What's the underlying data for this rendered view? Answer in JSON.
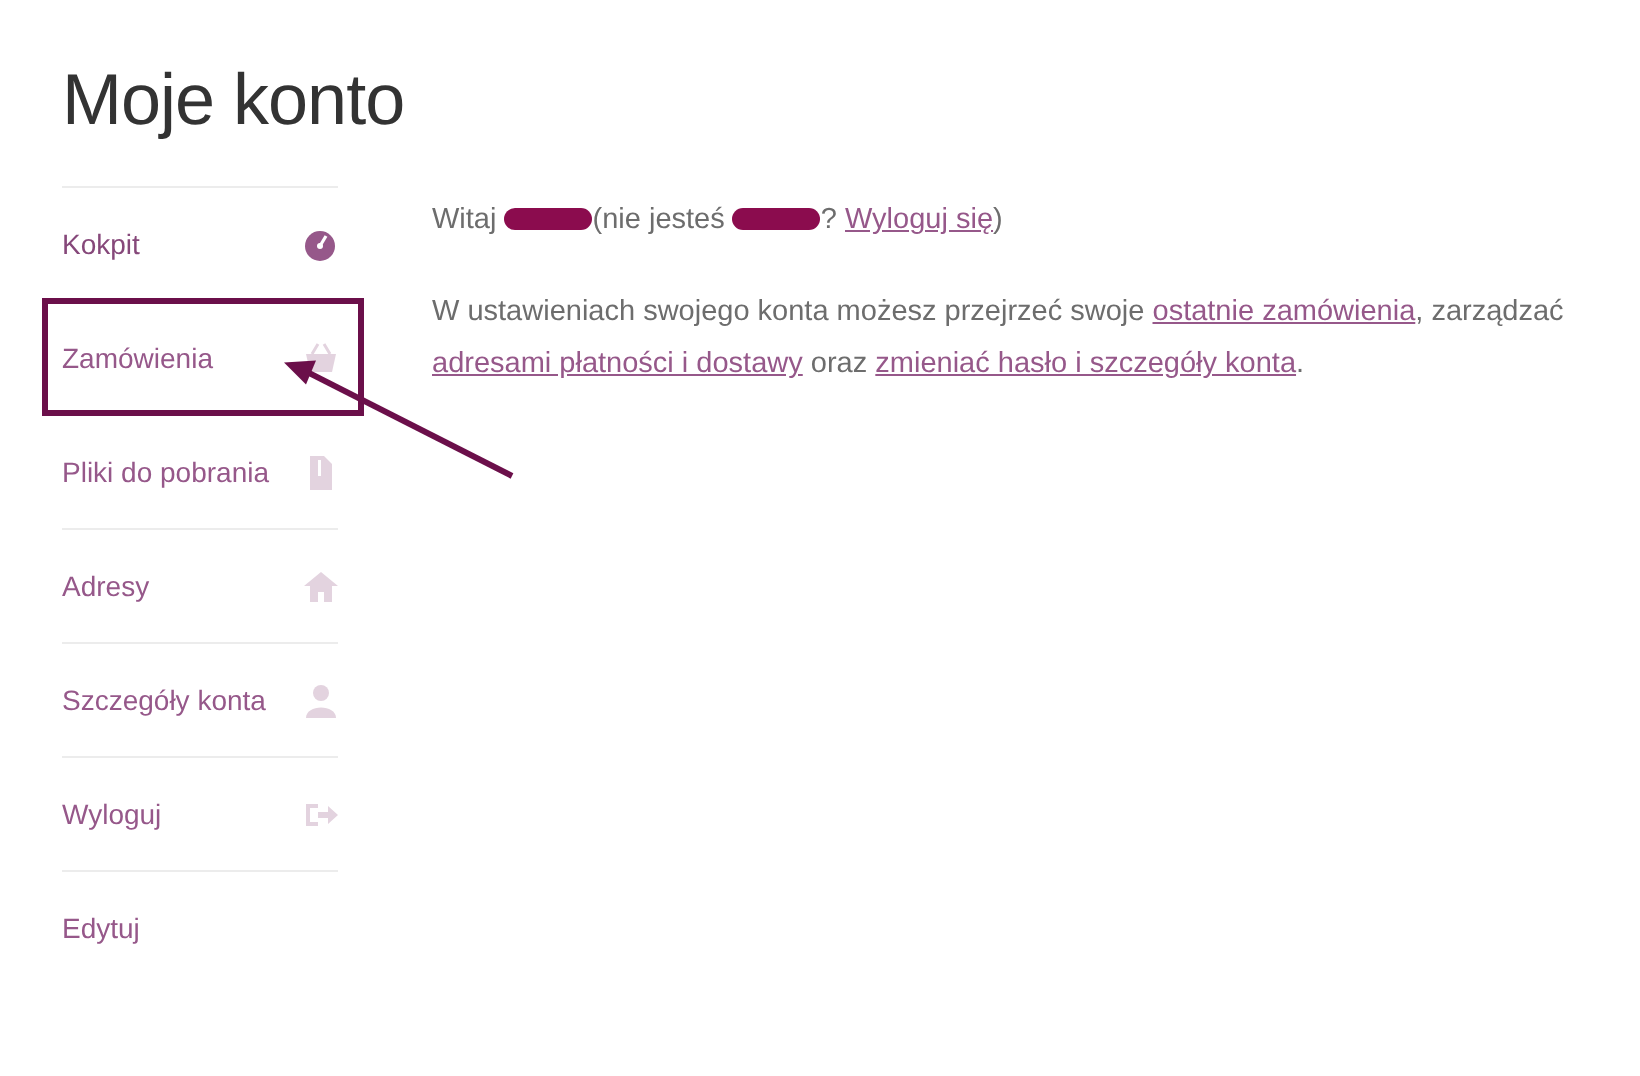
{
  "page_title": "Moje konto",
  "nav": [
    {
      "label": "Kokpit",
      "selected": true,
      "highlighted": false
    },
    {
      "label": "Zamówienia",
      "selected": false,
      "highlighted": true
    },
    {
      "label": "Pliki do pobrania",
      "selected": false,
      "highlighted": false
    },
    {
      "label": "Adresy",
      "selected": false,
      "highlighted": false
    },
    {
      "label": "Szczegóły konta",
      "selected": false,
      "highlighted": false
    },
    {
      "label": "Wyloguj",
      "selected": false,
      "highlighted": false
    },
    {
      "label": "Edytuj",
      "selected": false,
      "highlighted": false
    }
  ],
  "greeting": [
    {
      "kind": "text",
      "text": "Witaj"
    },
    {
      "kind": "redacted"
    },
    {
      "kind": "text",
      "text": "(nie jesteś"
    },
    {
      "kind": "redacted"
    },
    {
      "kind": "text",
      "text": "?"
    },
    {
      "kind": "link",
      "text": "Wyloguj się"
    },
    {
      "kind": "text",
      "text": ")"
    }
  ],
  "intro": [
    {
      "kind": "text",
      "text": "W ustawieniach swojego konta możesz przejrzeć swoje"
    },
    {
      "kind": "link",
      "text": "ostatnie zamówienia"
    },
    {
      "kind": "text",
      "text": ", zarządzać"
    },
    {
      "kind": "link",
      "text": "adresami płatności i dostawy"
    },
    {
      "kind": "text",
      "text": "oraz"
    },
    {
      "kind": "link",
      "text": "zmieniać hasło i szczegóły konta"
    },
    {
      "kind": "text",
      "text": "."
    }
  ],
  "annotation": {
    "arrow": true
  }
}
